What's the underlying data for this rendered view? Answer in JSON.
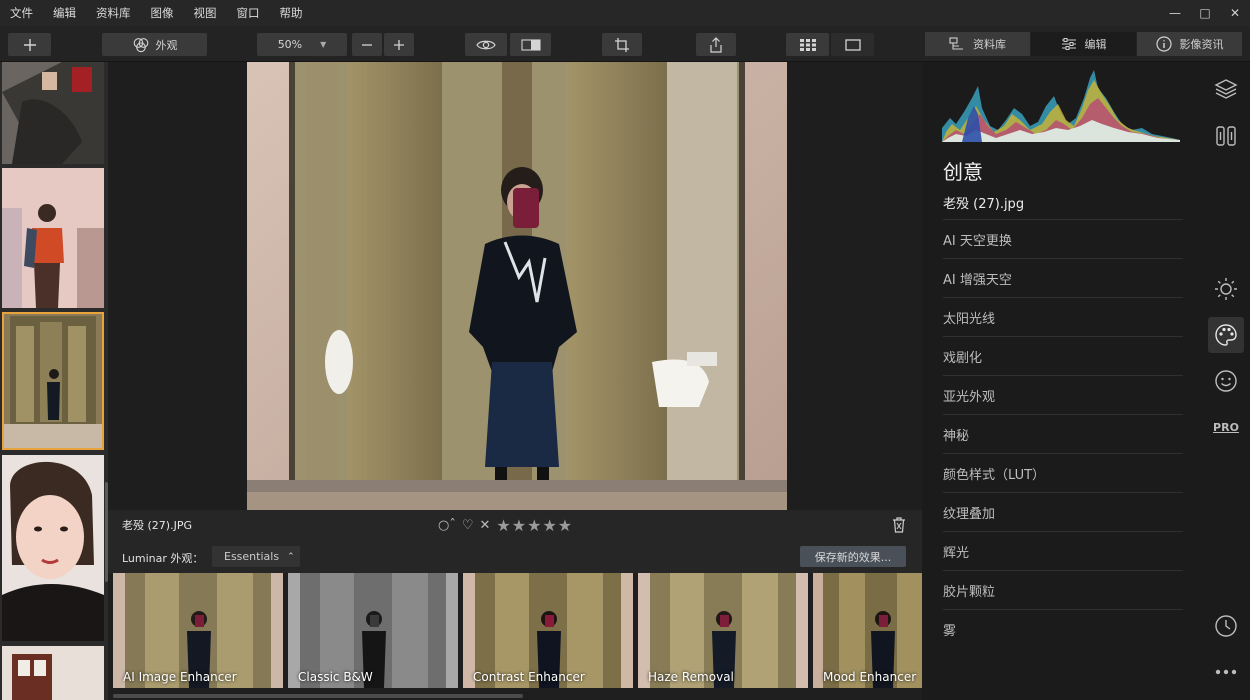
{
  "menu": [
    "文件",
    "编辑",
    "资料库",
    "图像",
    "视图",
    "窗口",
    "帮助"
  ],
  "toolbar": {
    "looks_label": "外观",
    "zoom_value": "50%",
    "tabs": [
      {
        "label": "资料库",
        "active": false
      },
      {
        "label": "编辑",
        "active": true
      },
      {
        "label": "影像资讯",
        "active": false
      }
    ]
  },
  "image": {
    "filename": "老殁 (27).JPG"
  },
  "looks": {
    "label": "Luminar 外观：",
    "category": "Essentials",
    "save_label": "保存新的效果...",
    "items": [
      "AI Image Enhancer",
      "Classic B&W",
      "Contrast Enhancer",
      "Haze Removal",
      "Mood Enhancer"
    ]
  },
  "panel": {
    "title": "创意",
    "file": "老殁 (27).jpg",
    "tools": [
      "AI 天空更换",
      "AI 增强天空",
      "太阳光线",
      "戏剧化",
      "亚光外观",
      "神秘",
      "颜色样式（LUT）",
      "纹理叠加",
      "辉光",
      "胶片颗粒",
      "雾"
    ]
  },
  "sidebar_icons": [
    "layers-icon",
    "canvas-icon",
    "essentials-sun-icon",
    "creative-palette-icon",
    "portrait-face-icon",
    "pro-icon",
    "history-clock-icon",
    "more-icon"
  ],
  "colors": {
    "accent": "#e8a33c",
    "panel_bg": "#1b1b1b"
  }
}
